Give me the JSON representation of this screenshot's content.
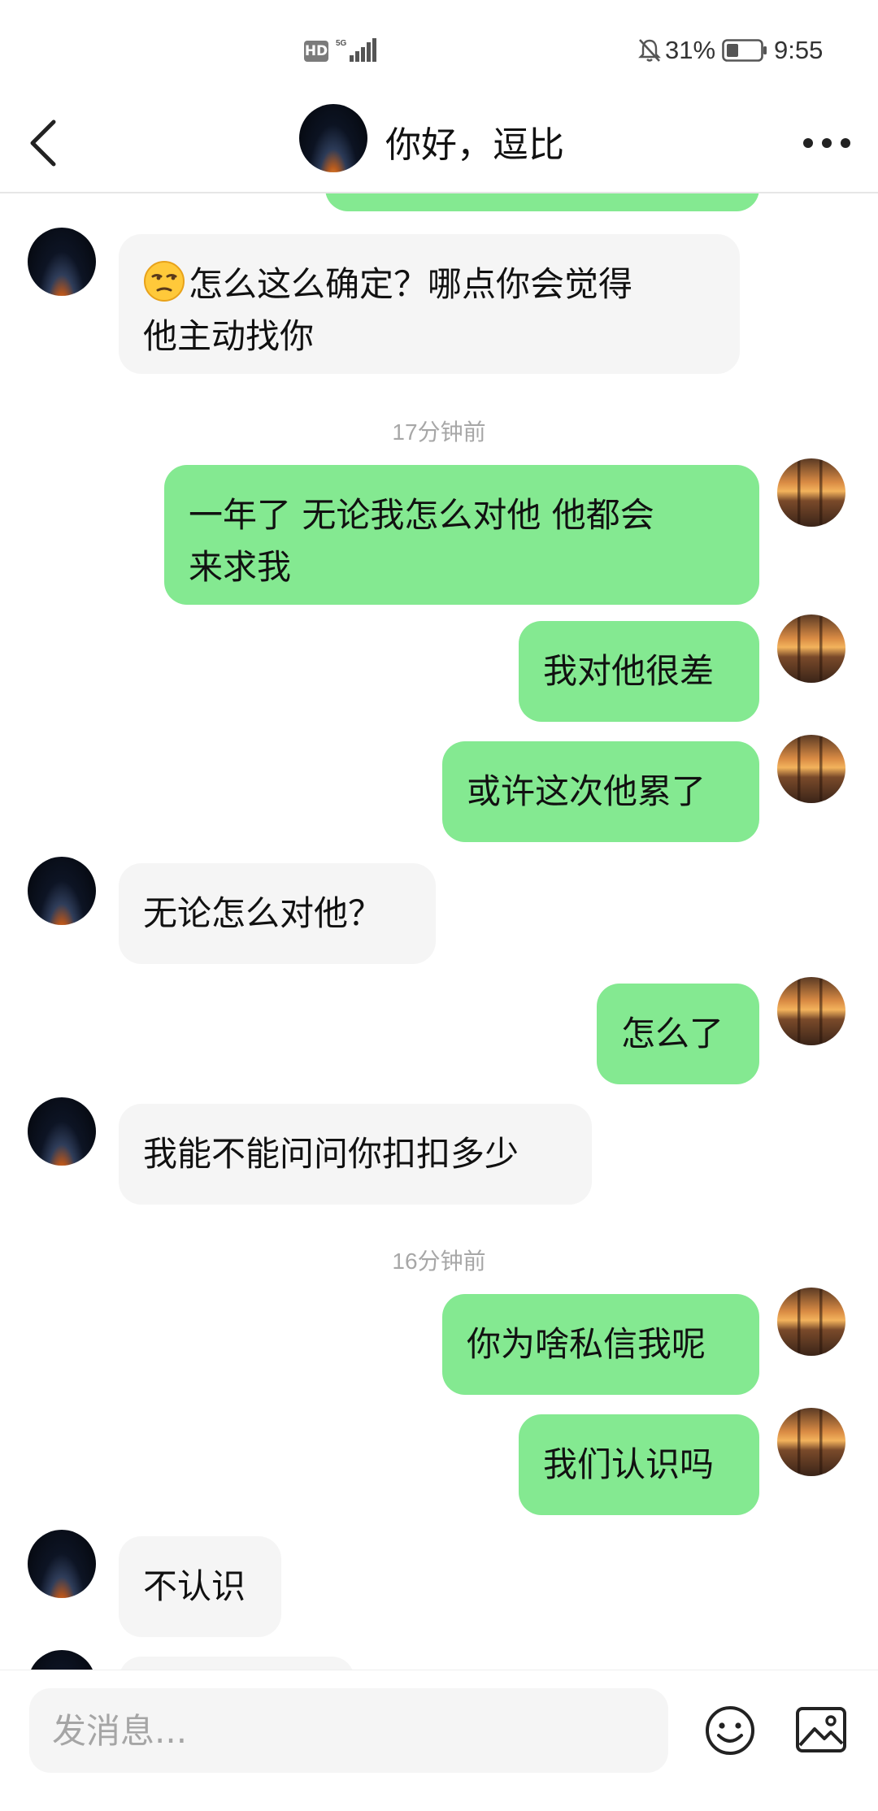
{
  "status_bar": {
    "hd_label": "HD",
    "network_label": "5G",
    "battery_percent": "31%",
    "time": "9:55",
    "icons": [
      "hd-icon",
      "signal-icon",
      "mute-bell-icon",
      "battery-icon"
    ]
  },
  "header": {
    "title": "你好，逗比",
    "back_icon": "chevron-left-icon",
    "more_icon": "more-dots-icon"
  },
  "messages": [
    {
      "side": "in",
      "text_prefix_icon": "unamused-face-emoji",
      "text": "怎么这么确定？哪点你会觉得他主动找你",
      "line1": "怎么这么确定？哪点你会觉得",
      "line2": "他主动找你"
    },
    {
      "type": "timestamp",
      "text": "17分钟前"
    },
    {
      "side": "out",
      "line1": "一年了 无论我怎么对他 他都会",
      "line2": "来求我"
    },
    {
      "side": "out",
      "text": "我对他很差"
    },
    {
      "side": "out",
      "text": "或许这次他累了"
    },
    {
      "side": "in",
      "text": "无论怎么对他？"
    },
    {
      "side": "out",
      "text": "怎么了"
    },
    {
      "side": "in",
      "text": "我能不能问问你扣扣多少"
    },
    {
      "type": "timestamp",
      "text": "16分钟前"
    },
    {
      "side": "out",
      "text": "你为啥私信我呢"
    },
    {
      "side": "out",
      "text": "我们认识吗"
    },
    {
      "side": "in",
      "text": "不认识"
    }
  ],
  "input": {
    "placeholder": "发消息...",
    "value": ""
  },
  "colors": {
    "outgoing_bubble": "#84e991",
    "incoming_bubble": "#f5f5f5",
    "timestamp_text": "#a7a7a7"
  }
}
